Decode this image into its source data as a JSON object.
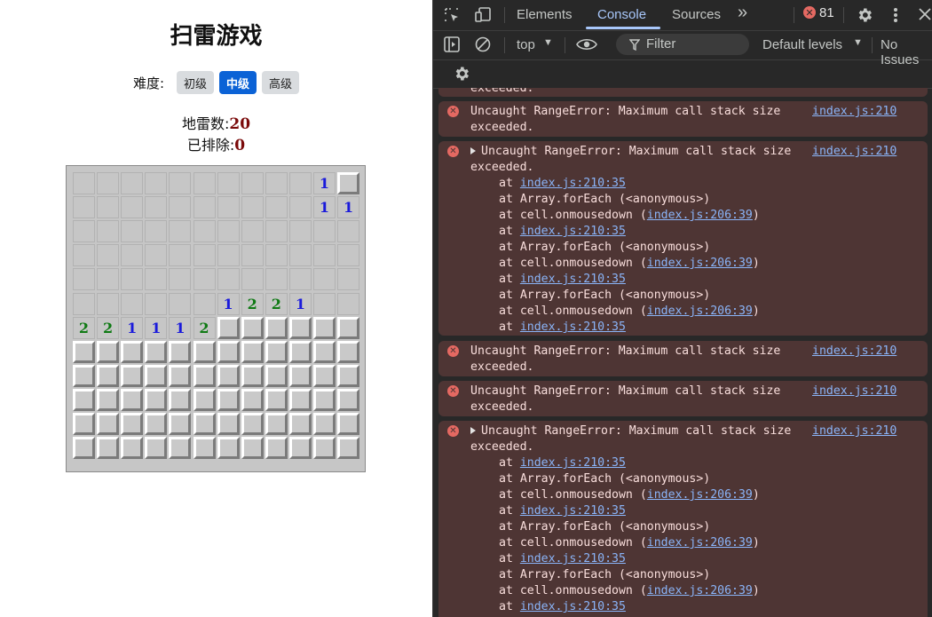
{
  "game": {
    "title": "扫雷游戏",
    "difficulty_label": "难度:",
    "levels": [
      "初级",
      "中级",
      "高级"
    ],
    "active_level": "中级",
    "mines_label": "地雷数:",
    "mines_value": "20",
    "cleared_label": "已排除:",
    "cleared_value": "0",
    "grid": [
      "..........1#",
      "..........11",
      "............",
      "............",
      "............",
      "......1221..",
      "221112######",
      "############",
      "############",
      "############",
      "############",
      "############"
    ]
  },
  "devtools": {
    "tabs": [
      "Elements",
      "Console",
      "Sources"
    ],
    "active_tab": "Console",
    "more_tabs": "»",
    "error_count": "81",
    "context": "top",
    "filter_placeholder": "Filter",
    "levels": "Default levels",
    "issues": "No Issues",
    "clipped_top": "exceeded.",
    "error_text": "Uncaught RangeError: Maximum call stack size",
    "error_cont": "exceeded.",
    "source": "index.js:210",
    "stack_at": "at",
    "stack_link_a": "index.js:210:35",
    "stack_foreach": "Array.forEach (<anonymous>)",
    "stack_cell_prefix": "cell.onmousedown (",
    "stack_link_b": "index.js:206:39",
    "stack_cell_suffix": ")"
  }
}
